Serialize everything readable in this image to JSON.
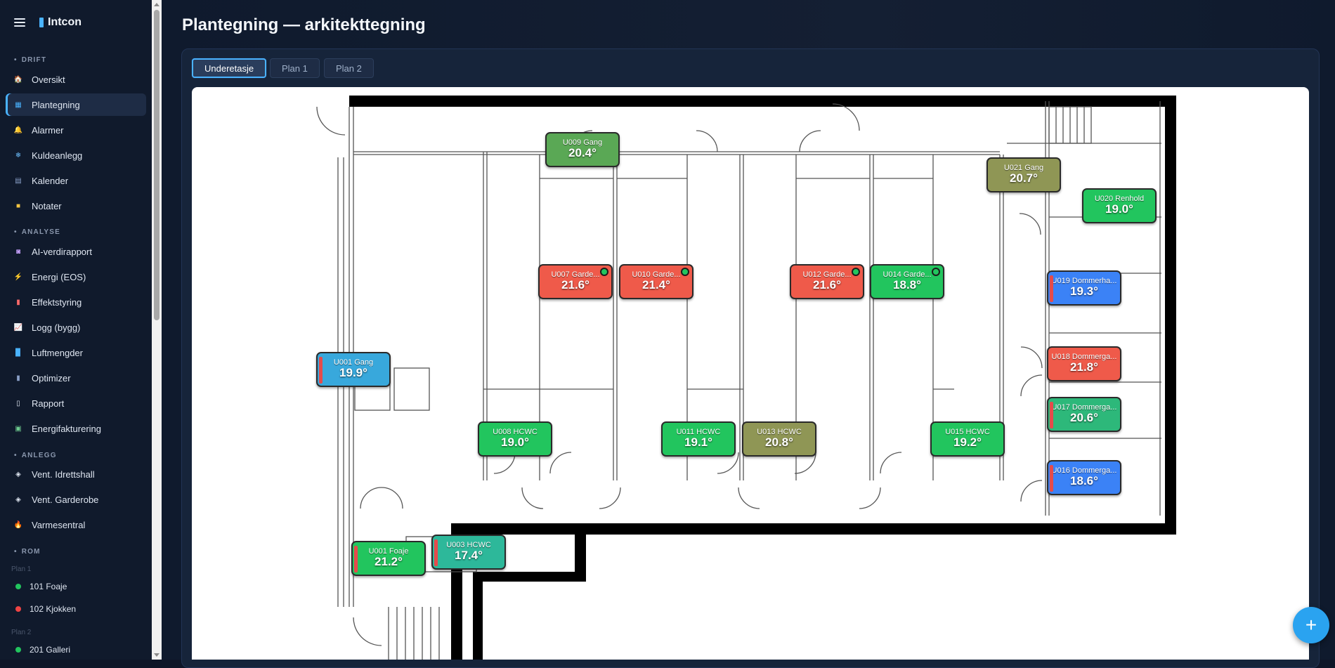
{
  "app": {
    "name": "Intcon"
  },
  "sidebar": {
    "sections": {
      "drift": "DRIFT",
      "analyse": "ANALYSE",
      "anlegg": "ANLEGG",
      "rom": "ROM"
    },
    "drift": [
      {
        "label": "Oversikt",
        "icon": "house-icon",
        "glyph": "🏠",
        "color": "#e06b4a"
      },
      {
        "label": "Plantegning",
        "icon": "floorplan-icon",
        "glyph": "▦",
        "color": "#4ab3ff"
      },
      {
        "label": "Alarmer",
        "icon": "bell-icon",
        "glyph": "🔔",
        "color": "#f5c542"
      },
      {
        "label": "Kuldeanlegg",
        "icon": "snowflake-icon",
        "glyph": "❄",
        "color": "#6ec1ff"
      },
      {
        "label": "Kalender",
        "icon": "calendar-icon",
        "glyph": "▤",
        "color": "#8aa0c8"
      },
      {
        "label": "Notater",
        "icon": "note-icon",
        "glyph": "■",
        "color": "#f5c542"
      }
    ],
    "analyse": [
      {
        "label": "AI-verdirapport",
        "icon": "robot-icon",
        "glyph": "◙",
        "color": "#c9a3ff"
      },
      {
        "label": "Energi (EOS)",
        "icon": "lightning-icon",
        "glyph": "⚡",
        "color": "#ff8a3d"
      },
      {
        "label": "Effektstyring",
        "icon": "gauge-icon",
        "glyph": "▮",
        "color": "#ff6a6a"
      },
      {
        "label": "Logg (bygg)",
        "icon": "chart-icon",
        "glyph": "📈",
        "color": "#9fc2ff"
      },
      {
        "label": "Luftmengder",
        "icon": "fan-icon",
        "glyph": "▉",
        "color": "#4ab3ff"
      },
      {
        "label": "Optimizer",
        "icon": "optimizer-icon",
        "glyph": "▮",
        "color": "#8aa0c8"
      },
      {
        "label": "Rapport",
        "icon": "document-icon",
        "glyph": "▯",
        "color": "#dfe6f1"
      },
      {
        "label": "Energifakturering",
        "icon": "invoice-icon",
        "glyph": "▣",
        "color": "#6ecb8f"
      }
    ],
    "anlegg": [
      {
        "label": "Vent. Idrettshall",
        "icon": "ventilation-icon",
        "glyph": "◈",
        "color": "#dfe6f1"
      },
      {
        "label": "Vent. Garderobe",
        "icon": "ventilation-icon",
        "glyph": "◈",
        "color": "#dfe6f1"
      },
      {
        "label": "Varmesentral",
        "icon": "flame-icon",
        "glyph": "🔥",
        "color": "#ff8a3d"
      }
    ],
    "rooms": {
      "plan1_label": "Plan 1",
      "plan2_label": "Plan 2",
      "items": [
        {
          "label": "101 Foaje",
          "status_color": "#22c55e"
        },
        {
          "label": "102 Kjokken",
          "status_color": "#ef4444"
        },
        {
          "label": "201 Galleri",
          "status_color": "#22c55e"
        }
      ]
    }
  },
  "page": {
    "title": "Plantegning — arkitekttegning"
  },
  "tabs": [
    "Underetasje",
    "Plan 1",
    "Plan 2"
  ],
  "active_tab": "Underetasje",
  "sensors": [
    {
      "name": "U009 Gang",
      "temp": "20.4°",
      "color": "#5aa855"
    },
    {
      "name": "U021 Gang",
      "temp": "20.7°",
      "color": "#8f9655"
    },
    {
      "name": "U020 Renhold",
      "temp": "19.0°",
      "color": "#22c55e"
    },
    {
      "name": "U007 Garde...",
      "temp": "21.6°",
      "color": "#ef5a4a",
      "dot": true
    },
    {
      "name": "U010 Garde...",
      "temp": "21.4°",
      "color": "#ef5a4a",
      "dot": true
    },
    {
      "name": "U012 Garde...",
      "temp": "21.6°",
      "color": "#ef5a4a",
      "dot": true
    },
    {
      "name": "U014 Garde...",
      "temp": "18.8°",
      "color": "#22c55e",
      "dot": true
    },
    {
      "name": "U019 Dommerha...",
      "temp": "19.3°",
      "color": "#3b82f6",
      "bar": true
    },
    {
      "name": "U001 Gang",
      "temp": "19.9°",
      "color": "#38a8dc",
      "bar": true
    },
    {
      "name": "U018 Dommerga...",
      "temp": "21.8°",
      "color": "#ef5a4a"
    },
    {
      "name": "U017 Dommerga...",
      "temp": "20.6°",
      "color": "#2db87a",
      "bar": true
    },
    {
      "name": "U008 HCWC",
      "temp": "19.0°",
      "color": "#22c55e"
    },
    {
      "name": "U011 HCWC",
      "temp": "19.1°",
      "color": "#22c55e"
    },
    {
      "name": "U013 HCWC",
      "temp": "20.8°",
      "color": "#8f9655"
    },
    {
      "name": "U015 HCWC",
      "temp": "19.2°",
      "color": "#22c55e"
    },
    {
      "name": "U016 Dommerga...",
      "temp": "18.6°",
      "color": "#3b82f6",
      "bar": true
    },
    {
      "name": "U001 Foaje",
      "temp": "21.2°",
      "color": "#22c55e",
      "bar": true
    },
    {
      "name": "U003 HCWC",
      "temp": "17.4°",
      "color": "#2db89a",
      "bar": true
    }
  ],
  "fab": {
    "label": "+",
    "icon": "plus-icon"
  }
}
